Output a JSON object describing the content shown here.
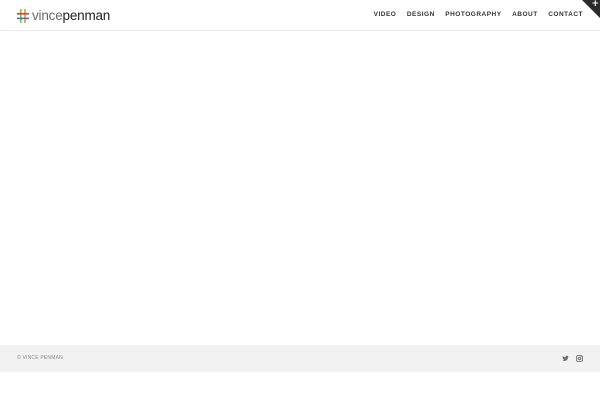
{
  "brand": {
    "logo_light": "vince",
    "logo_dark": "penman",
    "logo_icon": "hash-logo-icon",
    "colors": {
      "mark_green": "#8bbf3f",
      "mark_red": "#d9413b",
      "mark_orange": "#e8922c",
      "mark_blue": "#2d7fc1"
    }
  },
  "nav": {
    "items": [
      {
        "label": "VIDEO"
      },
      {
        "label": "DESIGN"
      },
      {
        "label": "PHOTOGRAPHY"
      },
      {
        "label": "ABOUT"
      },
      {
        "label": "CONTACT"
      }
    ]
  },
  "corner_toggle": {
    "icon": "plus-icon",
    "symbol": "+"
  },
  "footer": {
    "copyright": "© VINCE PENMAN",
    "social": [
      {
        "icon": "twitter-icon"
      },
      {
        "icon": "instagram-icon"
      }
    ]
  }
}
